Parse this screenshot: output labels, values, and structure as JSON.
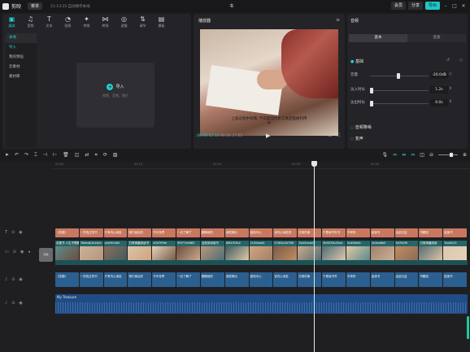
{
  "titlebar": {
    "app_name": "剪映",
    "menu_label": "菜单",
    "autosave": "21:13:35 自动保存本地",
    "project_title": "书",
    "pro_label": "会员",
    "share_label": "分享",
    "export_label": "导出"
  },
  "media": {
    "tools": [
      {
        "label": "媒体",
        "icon": "media-icon"
      },
      {
        "label": "音频",
        "icon": "audio-icon"
      },
      {
        "label": "文本",
        "icon": "text-icon"
      },
      {
        "label": "贴纸",
        "icon": "sticker-icon"
      },
      {
        "label": "特效",
        "icon": "effects-icon"
      },
      {
        "label": "转场",
        "icon": "transition-icon"
      },
      {
        "label": "滤镜",
        "icon": "filter-icon"
      },
      {
        "label": "调节",
        "icon": "adjust-icon"
      },
      {
        "label": "模板",
        "icon": "template-icon"
      }
    ],
    "sidebar": [
      "本地",
      "导入",
      "我的预设",
      "云素材",
      "素材库"
    ],
    "import_label": "导入",
    "import_hint": "视频、音频、图片"
  },
  "player": {
    "title": "播放器",
    "subtitle": "上坡过程中有我, 不仅能当代步工具还能被利用",
    "subtitle2": "件",
    "time_current": "00:00:12:14",
    "time_total": "00:04:27:01"
  },
  "props": {
    "header": "音频",
    "tabs": [
      "基本",
      "变速"
    ],
    "section": "基础",
    "volume_label": "音量",
    "volume_value": "-20.0dB",
    "fadein_label": "淡入时长",
    "fadein_value": "1.2s",
    "fadeout_label": "淡出时长",
    "fadeout_value": "0.0s",
    "footer1": "音频降噪",
    "footer2": "变声"
  },
  "timeline": {
    "ticks": [
      "00:00",
      "00:10",
      "00:20",
      "00:30",
      "00:40",
      "00:50",
      "01:00",
      "01:10"
    ],
    "text_clips": [
      "《花楼》",
      "一些真正的书",
      "只有内心深处",
      "他们读出的",
      "书中世界",
      "一边了解了",
      "跟随他的",
      "深居简出",
      "因而中心",
      "该内心深处的",
      "日常的事",
      "于是读书写书",
      "不停的",
      "品读书",
      "由品日益",
      "书籍如",
      "因读书"
    ],
    "video_heads": [
      "浓墨书 人生不需要",
      "78ebdb1b2b2c",
      "a2e9fc4b0",
      "日常清晨阅读书",
      "e3d7f99e",
      "9f077e4662",
      "治愈系阅读书",
      "6f61f53b2",
      "2150ba04",
      "f1362e2b7f6f",
      "2b43cedd3",
      "3b9033b45ae",
      "5cd06e5c",
      "2e2ba6b5",
      "9d7b0f9",
      "日常清晨阅读",
      "7bc8413"
    ],
    "audio_clips": [
      "《花楼》",
      "一些真正的书",
      "只有内心深处",
      "他们读出的",
      "书中世界",
      "一边了解了",
      "跟随他的",
      "深居简出",
      "因而中心",
      "该内心深处",
      "日常的事",
      "于是读书写",
      "不停的",
      "品读书",
      "由品日益",
      "书籍如",
      "因读书"
    ],
    "music_title": "My Treasure",
    "cover_label": "封面"
  }
}
